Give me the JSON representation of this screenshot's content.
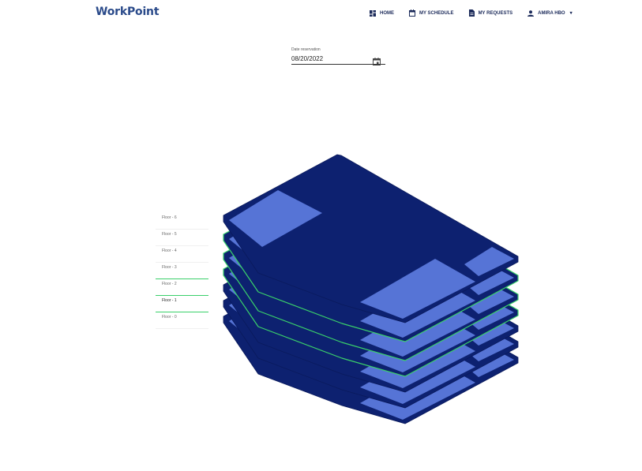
{
  "app": {
    "logo": "WorkPoint"
  },
  "nav": {
    "home": "HOME",
    "schedule": "MY SCHEDULE",
    "requests": "MY REQUESTS",
    "user": "AMIRA HBO"
  },
  "date": {
    "label": "Date reservation",
    "value": "08/20/2022"
  },
  "floors": [
    {
      "label": "Floor - 6"
    },
    {
      "label": "Floor - 5"
    },
    {
      "label": "Floor - 4"
    },
    {
      "label": "Floor - 3"
    },
    {
      "label": "Floor - 2"
    },
    {
      "label": "Floor - 1"
    },
    {
      "label": "Floor - 0"
    }
  ],
  "colors": {
    "slab": "#0d2170",
    "room": "#5674d6",
    "highlight": "#3ad06a"
  }
}
